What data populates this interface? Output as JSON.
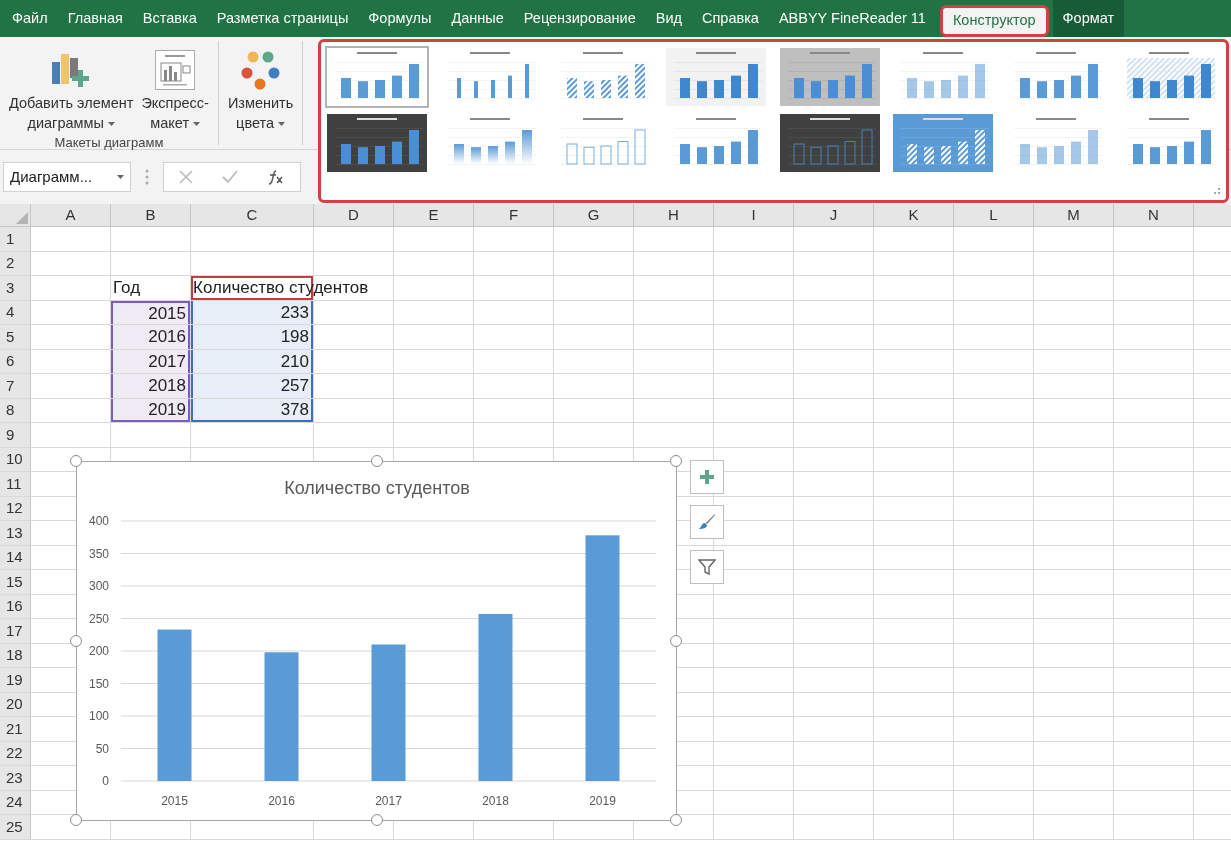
{
  "tabs": [
    {
      "label": "Файл",
      "selected": false,
      "contextual": false,
      "highlighted": false
    },
    {
      "label": "Главная",
      "selected": false,
      "contextual": false,
      "highlighted": false
    },
    {
      "label": "Вставка",
      "selected": false,
      "contextual": false,
      "highlighted": false
    },
    {
      "label": "Разметка страницы",
      "selected": false,
      "contextual": false,
      "highlighted": false
    },
    {
      "label": "Формулы",
      "selected": false,
      "contextual": false,
      "highlighted": false
    },
    {
      "label": "Данные",
      "selected": false,
      "contextual": false,
      "highlighted": false
    },
    {
      "label": "Рецензирование",
      "selected": false,
      "contextual": false,
      "highlighted": false
    },
    {
      "label": "Вид",
      "selected": false,
      "contextual": false,
      "highlighted": false
    },
    {
      "label": "Справка",
      "selected": false,
      "contextual": false,
      "highlighted": false
    },
    {
      "label": "ABBYY FineReader 11",
      "selected": false,
      "contextual": false,
      "highlighted": false
    },
    {
      "label": "Конструктор",
      "selected": true,
      "contextual": true,
      "highlighted": true
    },
    {
      "label": "Формат",
      "selected": false,
      "contextual": true,
      "highlighted": false
    }
  ],
  "ribbon": {
    "groups": [
      {
        "label": "Макеты диаграмм",
        "buttons": [
          {
            "kind": "add-element",
            "lines": [
              "Добавить элемент",
              "диаграммы"
            ]
          },
          {
            "kind": "quick-layout",
            "lines": [
              "Экспресс-",
              "макет"
            ]
          }
        ]
      },
      {
        "buttons": [
          {
            "kind": "colors",
            "lines": [
              "Изменить",
              "цвета"
            ]
          }
        ]
      }
    ]
  },
  "style_gallery": {
    "highlighted": true,
    "styles": [
      {
        "kind": "plain",
        "selected": true
      },
      {
        "kind": "thin",
        "selected": false
      },
      {
        "kind": "striped",
        "selected": false
      },
      {
        "kind": "shaded",
        "selected": false
      },
      {
        "kind": "gray",
        "selected": false
      },
      {
        "kind": "pale",
        "selected": false
      },
      {
        "kind": "plain",
        "selected": false
      },
      {
        "kind": "hatched",
        "selected": false
      },
      {
        "kind": "dark",
        "selected": false
      },
      {
        "kind": "gradient",
        "selected": false
      },
      {
        "kind": "outline",
        "selected": false
      },
      {
        "kind": "plain",
        "selected": false
      },
      {
        "kind": "darkoutline",
        "selected": false
      },
      {
        "kind": "blue",
        "selected": false
      },
      {
        "kind": "pale",
        "selected": false
      },
      {
        "kind": "plain",
        "selected": false
      }
    ]
  },
  "formula_bar": {
    "name_box": "Диаграмм..."
  },
  "sheet": {
    "columns": [
      "A",
      "B",
      "C",
      "D",
      "E",
      "F",
      "G",
      "H",
      "I",
      "J",
      "K",
      "L",
      "M",
      "N"
    ],
    "rows": [
      "1",
      "2",
      "3",
      "4",
      "5",
      "6",
      "7",
      "8",
      "9",
      "10",
      "11",
      "12",
      "13",
      "14",
      "15",
      "16",
      "17",
      "18",
      "19",
      "20",
      "21",
      "22",
      "23",
      "24",
      "25"
    ],
    "table": {
      "header": {
        "year": "Год",
        "count": "Количество студентов"
      },
      "rows": [
        {
          "year": "2015",
          "count": "233"
        },
        {
          "year": "2016",
          "count": "198"
        },
        {
          "year": "2017",
          "count": "210"
        },
        {
          "year": "2018",
          "count": "257"
        },
        {
          "year": "2019",
          "count": "378"
        }
      ]
    }
  },
  "chart": {
    "chart_data": {
      "type": "bar",
      "title": "Количество студентов",
      "categories": [
        "2015",
        "2016",
        "2017",
        "2018",
        "2019"
      ],
      "series": [
        {
          "color": "#5b9bd5",
          "values": [
            233,
            198,
            210,
            257,
            378
          ]
        }
      ],
      "ylim": [
        0,
        400
      ],
      "grid": true,
      "yticks": [
        0,
        50,
        100,
        150,
        200,
        250,
        300,
        350,
        400
      ]
    }
  }
}
